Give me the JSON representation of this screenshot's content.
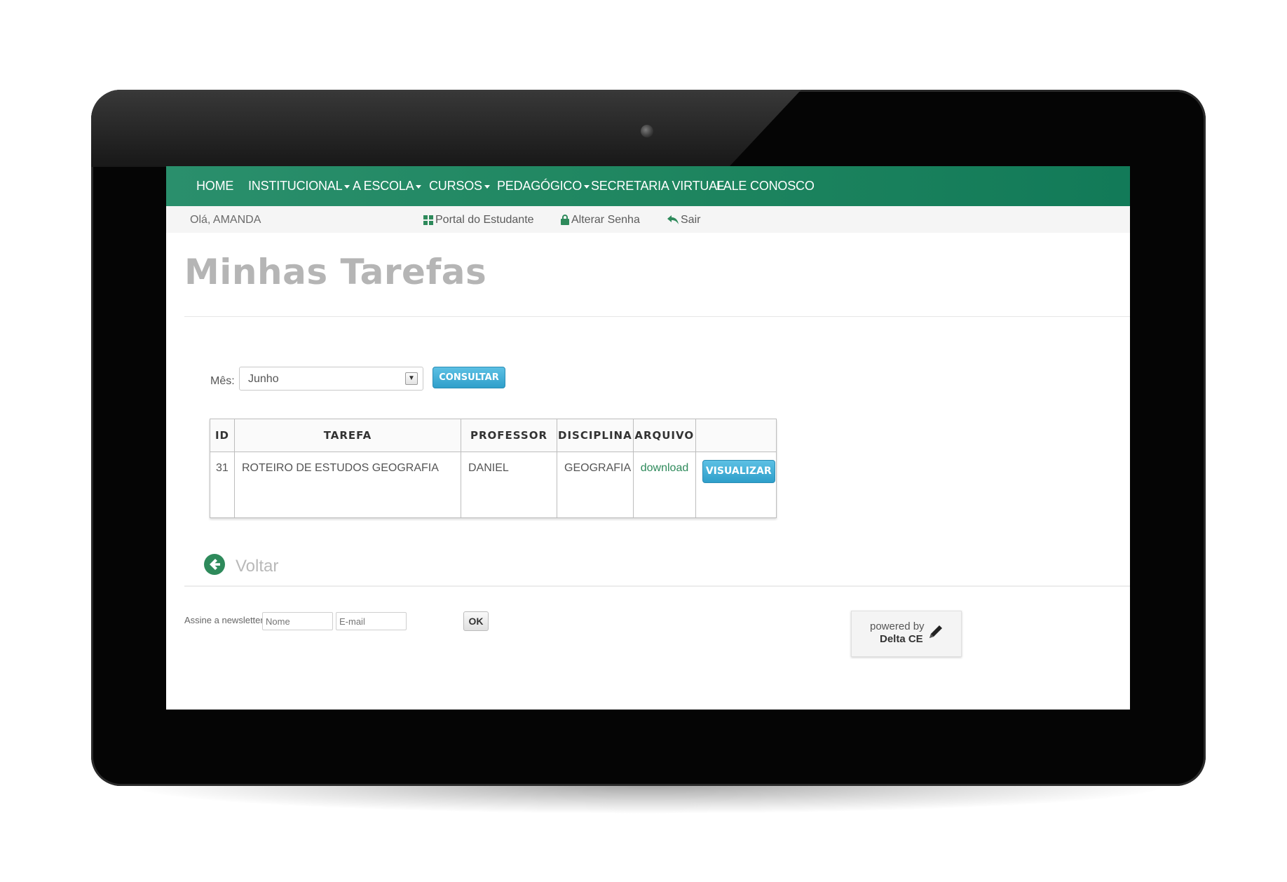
{
  "nav": {
    "items": [
      {
        "label": "HOME",
        "dropdown": false
      },
      {
        "label": "INSTITUCIONAL",
        "dropdown": true
      },
      {
        "label": "A ESCOLA",
        "dropdown": true
      },
      {
        "label": "CURSOS",
        "dropdown": true
      },
      {
        "label": "PEDAGÓGICO",
        "dropdown": true
      },
      {
        "label": "SECRETARIA VIRTUAL",
        "dropdown": false
      },
      {
        "label": "FALE CONOSCO",
        "dropdown": false
      }
    ]
  },
  "subbar": {
    "greeting": "Olá, AMANDA",
    "portal": "Portal do Estudante",
    "alterar": "Alterar Senha",
    "sair": "Sair"
  },
  "page": {
    "title": "Minhas Tarefas"
  },
  "filter": {
    "label": "Mês:",
    "selected": "Junho",
    "button": "CONSULTAR"
  },
  "table": {
    "headers": [
      "ID",
      "TAREFA",
      "PROFESSOR",
      "DISCIPLINA",
      "ARQUIVO",
      ""
    ],
    "rows": [
      {
        "id": "31",
        "tarefa": "ROTEIRO DE ESTUDOS GEOGRAFIA",
        "professor": "DANIEL",
        "disciplina": "GEOGRAFIA",
        "arquivo": "download",
        "action": "VISUALIZAR"
      }
    ]
  },
  "voltar": "Voltar",
  "newsletter": {
    "label": "Assine a newsletter:",
    "name_placeholder": "Nome",
    "email_placeholder": "E-mail",
    "ok": "OK"
  },
  "powered": {
    "line1": "powered by",
    "line2": "Delta CE"
  },
  "colors": {
    "nav_green": "#1f8660",
    "button_blue": "#3aa9d3",
    "link_green": "#2e8a5b"
  },
  "icons": [
    "grid-icon",
    "lock-icon",
    "reply-icon",
    "arrow-left-circle-icon",
    "pencil-icon"
  ]
}
